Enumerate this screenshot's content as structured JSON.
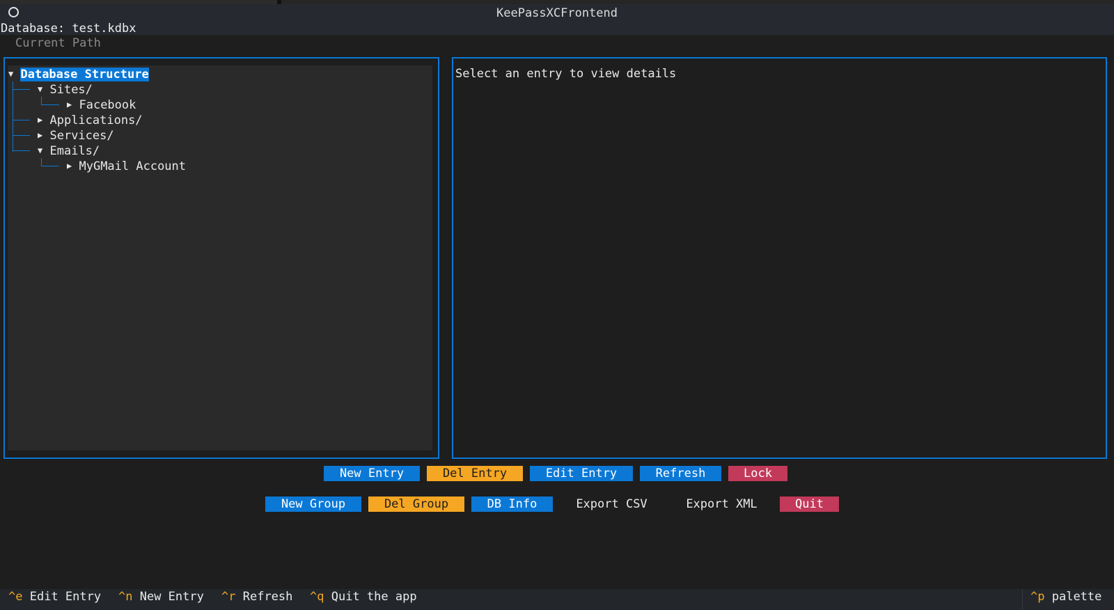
{
  "window": {
    "title": "KeePassXCFrontend"
  },
  "database_label": "Database: test.kdbx",
  "current_path": "Current Path",
  "tree": {
    "root": "Database Structure",
    "sites": "Sites/",
    "facebook": "Facebook",
    "applications": "Applications/",
    "services": "Services/",
    "emails": "Emails/",
    "gmail": "MyGMail Account"
  },
  "detail": {
    "placeholder": "Select an entry to view details"
  },
  "buttons": {
    "new_entry": "New Entry",
    "del_entry": "Del Entry",
    "edit_entry": "Edit Entry",
    "refresh": "Refresh",
    "lock": "Lock",
    "new_group": "New Group",
    "del_group": "Del Group",
    "db_info": "DB Info",
    "export_csv": "Export CSV",
    "export_xml": "Export XML",
    "quit": "Quit"
  },
  "footer": {
    "edit": {
      "key": "^e",
      "label": "Edit Entry"
    },
    "new": {
      "key": "^n",
      "label": "New Entry"
    },
    "refresh": {
      "key": "^r",
      "label": "Refresh"
    },
    "quit": {
      "key": "^q",
      "label": "Quit the app"
    },
    "palette": {
      "key": "^p",
      "label": "palette"
    }
  },
  "colors": {
    "accent_blue": "#0b78d6",
    "warning_orange": "#f5a623",
    "danger_red": "#c2395a",
    "background": "#1e1e1e"
  }
}
